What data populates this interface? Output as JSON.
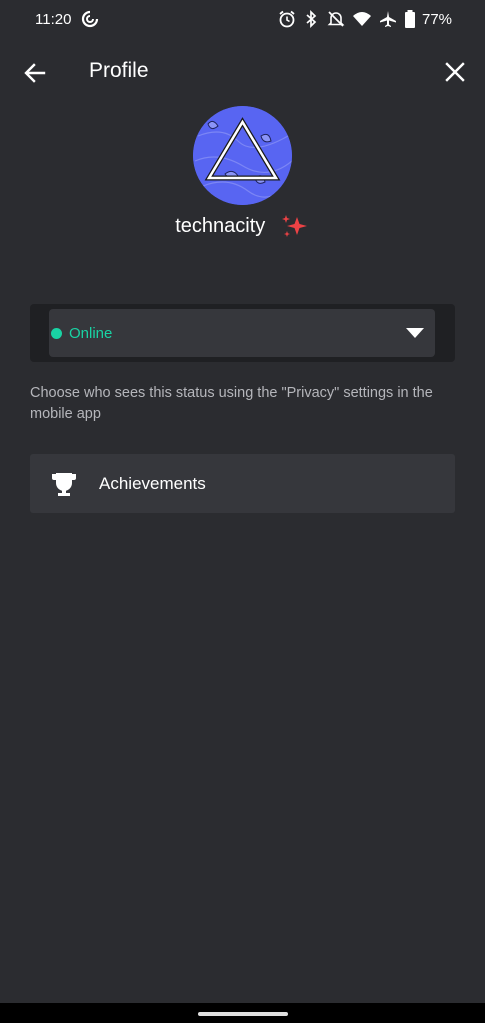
{
  "status_bar": {
    "time": "11:20",
    "battery": "77%",
    "icons": [
      "sync-icon",
      "alarm-icon",
      "bluetooth-icon",
      "notifications-off-icon",
      "wifi-icon",
      "airplane-icon",
      "battery-icon"
    ]
  },
  "header": {
    "title": "Profile",
    "back_icon": "arrow-left-icon",
    "close_icon": "close-icon"
  },
  "profile": {
    "username": "technacity",
    "avatar_color": "#5865f2",
    "sparkle_color": "#ed4245"
  },
  "status": {
    "selected": "Online",
    "color": "#19d3a4"
  },
  "privacy_note": "Choose who sees this status using the \"Privacy\" settings in the mobile app",
  "achievements": {
    "label": "Achievements",
    "icon": "trophy-icon"
  }
}
